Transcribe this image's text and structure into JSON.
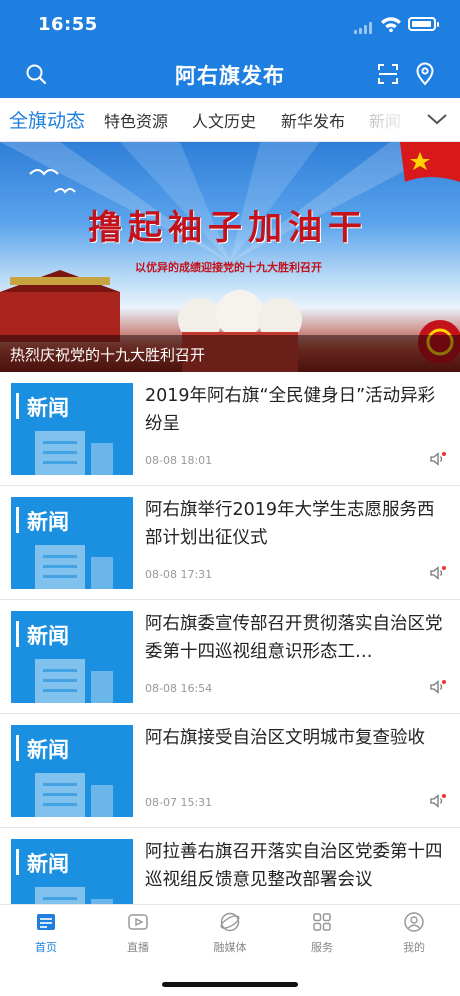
{
  "status": {
    "time": "16:55"
  },
  "header": {
    "title": "阿右旗发布"
  },
  "tabs": [
    {
      "label": "全旗动态"
    },
    {
      "label": "特色资源"
    },
    {
      "label": "人文历史"
    },
    {
      "label": "新华发布"
    },
    {
      "label": "新闻"
    }
  ],
  "banner": {
    "slogan": "撸起袖子加油干",
    "subtitle": "以优异的成绩迎接党的十九大胜利召开",
    "caption": "热烈庆祝党的十九大胜利召开"
  },
  "news": [
    {
      "thumb_label": "新闻",
      "title": "2019年阿右旗“全民健身日”活动异彩纷呈",
      "date": "08-08 18:01"
    },
    {
      "thumb_label": "新闻",
      "title": "阿右旗举行2019年大学生志愿服务西部计划出征仪式",
      "date": "08-08 17:31"
    },
    {
      "thumb_label": "新闻",
      "title": "阿右旗委宣传部召开贯彻落实自治区党委第十四巡视组意识形态工…",
      "date": "08-08 16:54"
    },
    {
      "thumb_label": "新闻",
      "title": "阿右旗接受自治区文明城市复查验收",
      "date": "08-07 15:31"
    },
    {
      "thumb_label": "新闻",
      "title": "阿拉善右旗召开落实自治区党委第十四巡视组反馈意见整改部署会议",
      "date": ""
    }
  ],
  "bottom_nav": [
    {
      "label": "首页",
      "icon": "news-icon"
    },
    {
      "label": "直播",
      "icon": "play-icon"
    },
    {
      "label": "融媒体",
      "icon": "globe-icon"
    },
    {
      "label": "服务",
      "icon": "grid-icon"
    },
    {
      "label": "我的",
      "icon": "user-icon"
    }
  ],
  "colors": {
    "brand": "#1e7fe0",
    "thumb": "#1b8fe0",
    "slogan": "#c4121c"
  }
}
